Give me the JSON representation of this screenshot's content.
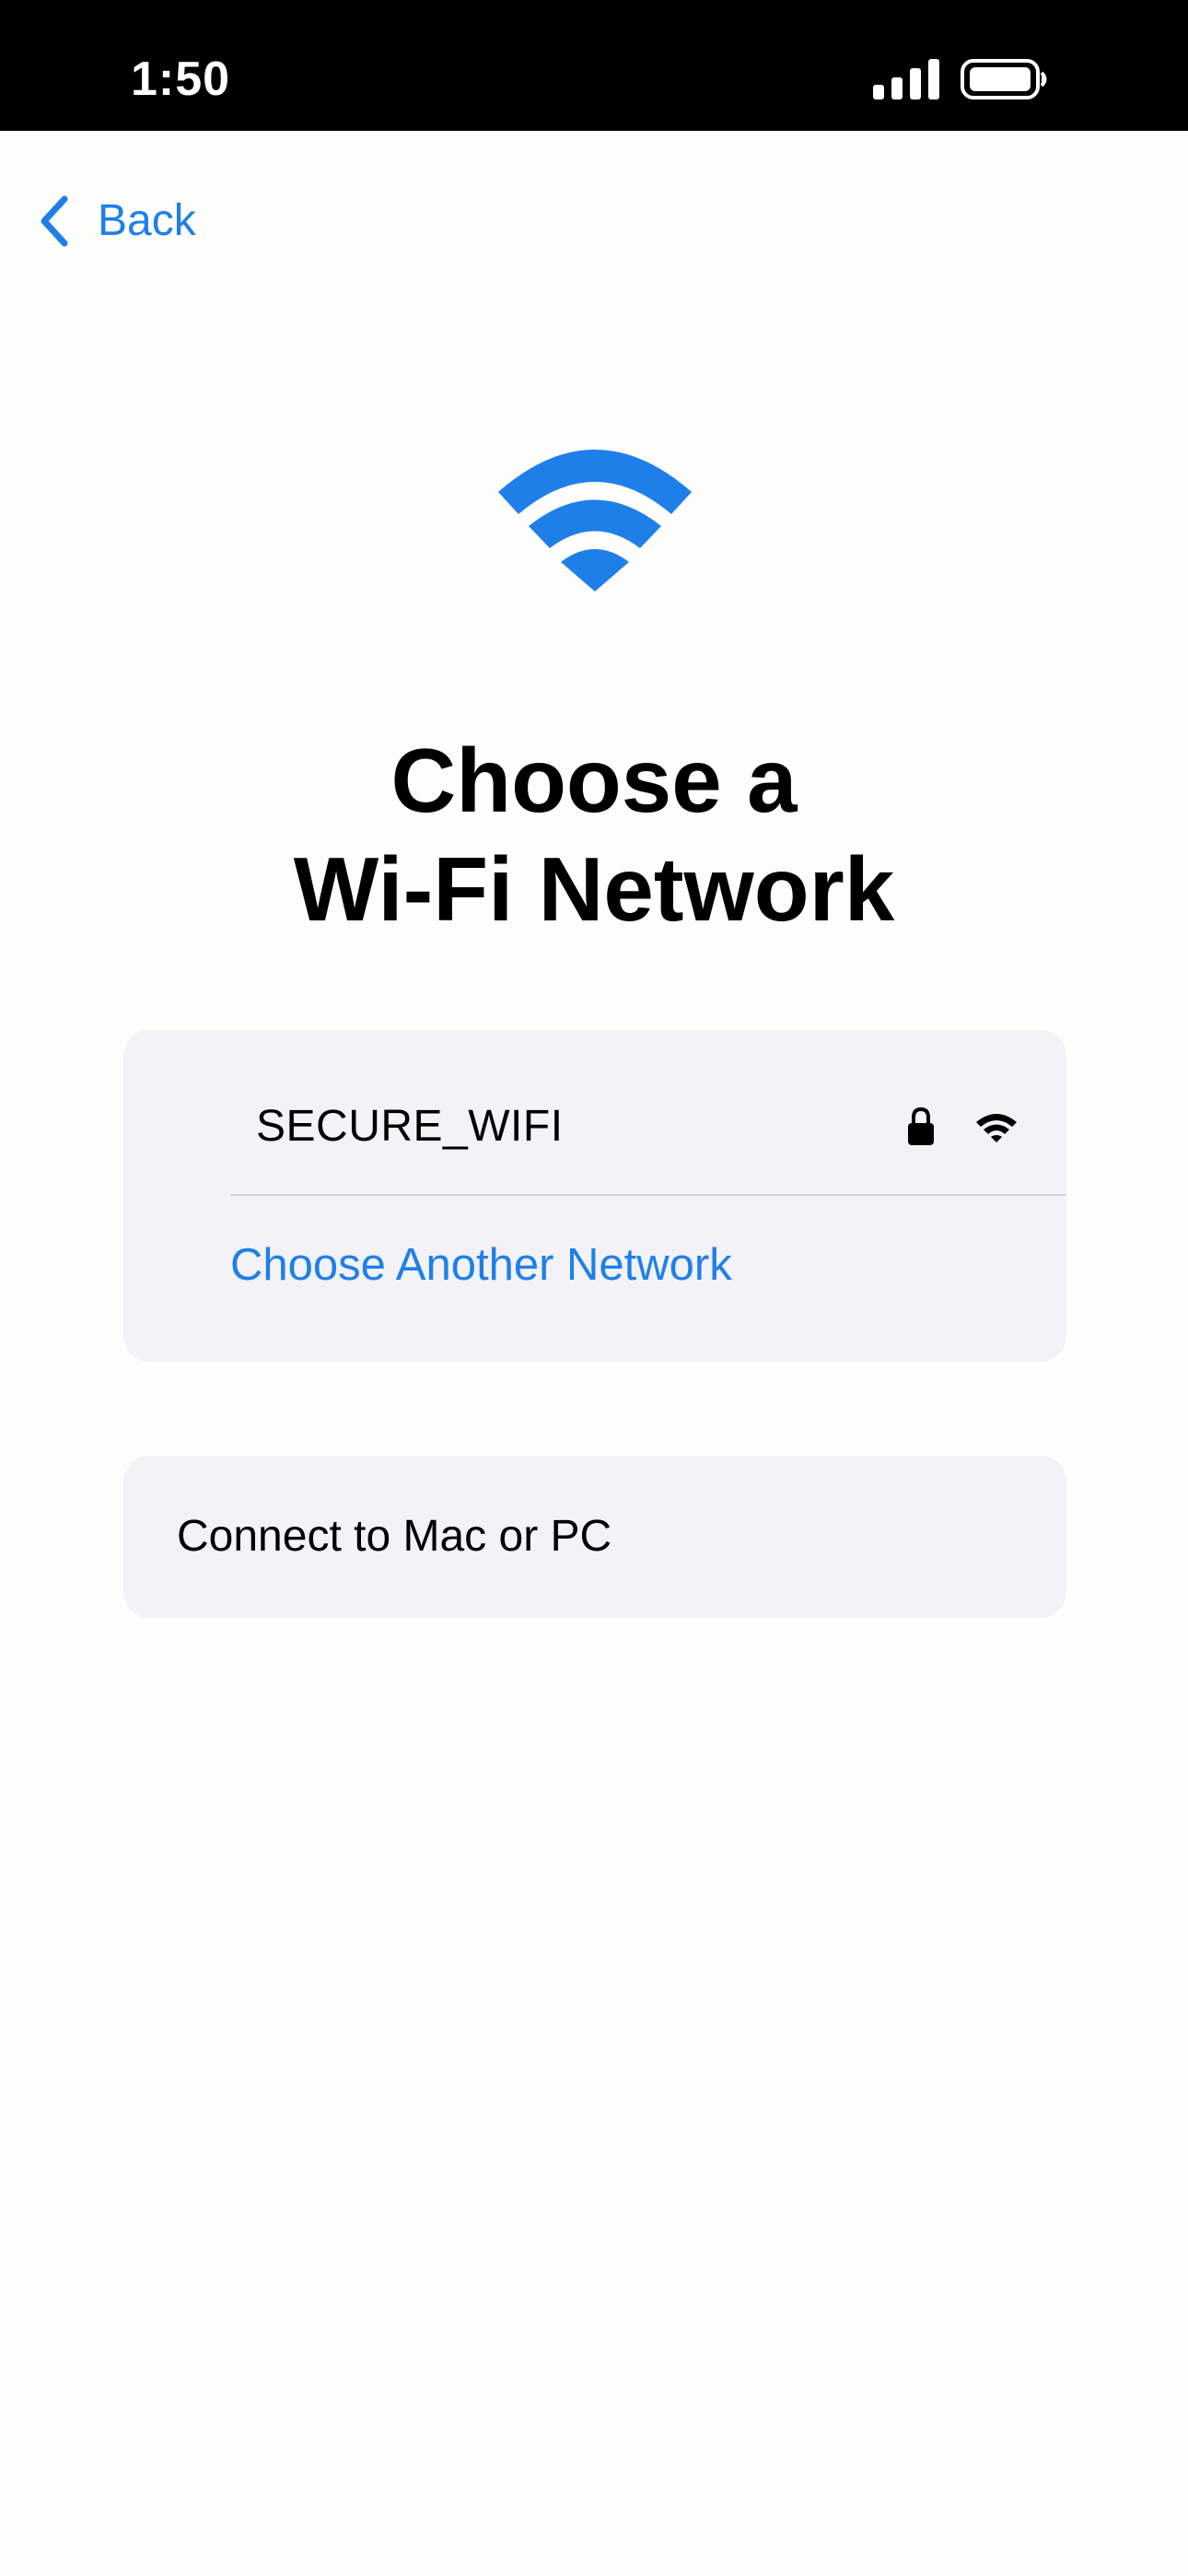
{
  "status_bar": {
    "time": "1:50",
    "signal_icon": "cellular-signal-icon",
    "battery_icon": "battery-icon"
  },
  "navigation": {
    "back_label": "Back",
    "back_icon": "chevron-left-icon"
  },
  "hero": {
    "icon": "wifi-icon",
    "title_line_1": "Choose a",
    "title_line_2": "Wi-Fi Network"
  },
  "networks": {
    "current": {
      "name": "SECURE_WIFI",
      "secured_icon": "lock-icon",
      "signal_icon": "wifi-signal-icon"
    },
    "choose_another_label": "Choose Another Network"
  },
  "options": {
    "connect_computer_label": "Connect to Mac or PC"
  },
  "colors": {
    "accent": "#1f7fe8",
    "status_bar_background": "#000000",
    "card_background": "#f2f2f7",
    "page_background": "#fdfdfb"
  }
}
